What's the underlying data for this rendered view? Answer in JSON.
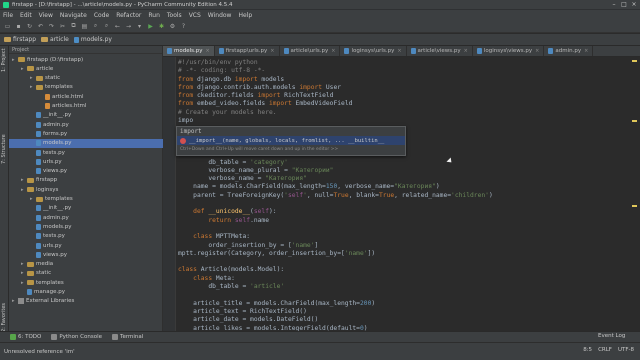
{
  "window": {
    "title": "firstapp - [D:\\firstapp] - ...\\article\\models.py - PyCharm Community Edition 4.5.4"
  },
  "menu": [
    "File",
    "Edit",
    "View",
    "Navigate",
    "Code",
    "Refactor",
    "Run",
    "Tools",
    "VCS",
    "Window",
    "Help"
  ],
  "breadcrumb": [
    "firstapp",
    "article",
    "models.py"
  ],
  "project": {
    "header": "Project",
    "items": [
      {
        "label": "firstapp (D:\\firstapp)",
        "type": "folder",
        "depth": 0
      },
      {
        "label": "article",
        "type": "folder",
        "depth": 1
      },
      {
        "label": "static",
        "type": "folder",
        "depth": 2
      },
      {
        "label": "templates",
        "type": "folder",
        "depth": 2
      },
      {
        "label": "article.html",
        "type": "html",
        "depth": 3
      },
      {
        "label": "articles.html",
        "type": "html",
        "depth": 3
      },
      {
        "label": "__init__.py",
        "type": "py",
        "depth": 2
      },
      {
        "label": "admin.py",
        "type": "py",
        "depth": 2
      },
      {
        "label": "forms.py",
        "type": "py",
        "depth": 2
      },
      {
        "label": "models.py",
        "type": "py",
        "depth": 2,
        "selected": true
      },
      {
        "label": "tests.py",
        "type": "py",
        "depth": 2
      },
      {
        "label": "urls.py",
        "type": "py",
        "depth": 2
      },
      {
        "label": "views.py",
        "type": "py",
        "depth": 2
      },
      {
        "label": "firstapp",
        "type": "folder",
        "depth": 1
      },
      {
        "label": "loginsys",
        "type": "folder",
        "depth": 1
      },
      {
        "label": "templates",
        "type": "folder",
        "depth": 2
      },
      {
        "label": "__init__.py",
        "type": "py",
        "depth": 2
      },
      {
        "label": "admin.py",
        "type": "py",
        "depth": 2
      },
      {
        "label": "models.py",
        "type": "py",
        "depth": 2
      },
      {
        "label": "tests.py",
        "type": "py",
        "depth": 2
      },
      {
        "label": "urls.py",
        "type": "py",
        "depth": 2
      },
      {
        "label": "views.py",
        "type": "py",
        "depth": 2
      },
      {
        "label": "media",
        "type": "folder",
        "depth": 1
      },
      {
        "label": "static",
        "type": "folder",
        "depth": 1
      },
      {
        "label": "templates",
        "type": "folder",
        "depth": 1
      },
      {
        "label": "manage.py",
        "type": "py",
        "depth": 1
      },
      {
        "label": "External Libraries",
        "type": "lib",
        "depth": 0
      }
    ]
  },
  "tabs": [
    {
      "label": "models.py",
      "type": "py",
      "active": true
    },
    {
      "label": "firstapp\\urls.py",
      "type": "py"
    },
    {
      "label": "article\\urls.py",
      "type": "py"
    },
    {
      "label": "loginsys\\urls.py",
      "type": "py"
    },
    {
      "label": "article\\views.py",
      "type": "py"
    },
    {
      "label": "loginsys\\views.py",
      "type": "py"
    },
    {
      "label": "admin.py",
      "type": "py"
    }
  ],
  "code": [
    "#!/usr/bin/env python",
    "# -*- coding: utf-8 -*-",
    "from django.db import models",
    "from django.contrib.auth.models import User",
    "from ckeditor.fields import RichTextField",
    "from embed_video.fields import EmbedVideoField",
    "# Create your models here.",
    "impo",
    "",
    "",
    "",
    "    class Meta:",
    "        db_table = 'category'",
    "        verbose_name_plural = \"Категории\"",
    "        verbose_name = \"Категория\"",
    "    name = models.CharField(max_length=150, verbose_name=\"Категория\")",
    "    parent = TreeForeignKey('self', null=True, blank=True, related_name='children')",
    "",
    "    def __unicode__(self):",
    "        return self.name",
    "",
    "    class MPTTMeta:",
    "        order_insertion_by = ['name']",
    "mptt.register(Category, order_insertion_by=['name'])",
    "",
    "class Article(models.Model):",
    "    class Meta:",
    "        db_table = 'article'",
    "",
    "    article_title = models.CharField(max_length=200)",
    "    article_text = RichTextField()",
    "    article_date = models.DateField()",
    "    article_likes = models.IntegerField(default=0)"
  ],
  "autocomplete": {
    "typed": "import",
    "suggestion": "__import__(name, globals, locals, fromlist, ...  __builtin__",
    "hint": "Ctrl+Down and Ctrl+Up will move caret down and up in the editor  >>"
  },
  "bottom_tools": [
    "6: TODO",
    "Python Console",
    "Terminal"
  ],
  "event_log": "Event Log",
  "status": {
    "message": "Unresolved reference 'im'",
    "position": "8:5",
    "line_sep": "CRLF",
    "encoding": "UTF-8"
  }
}
